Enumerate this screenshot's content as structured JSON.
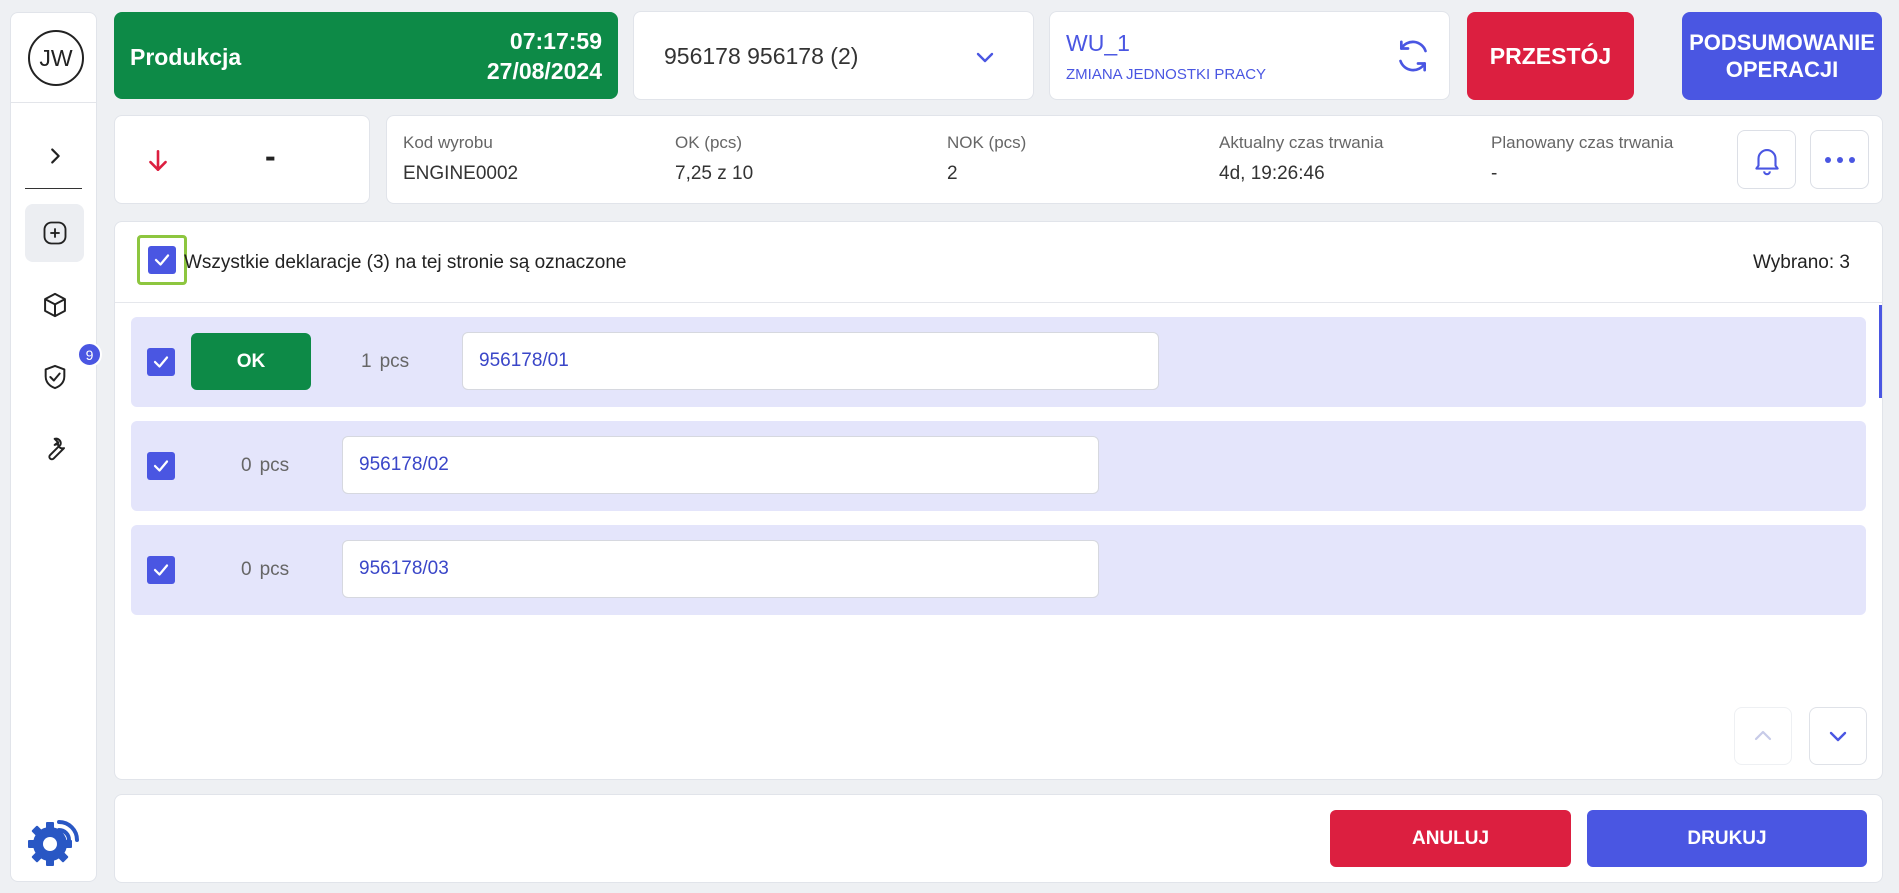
{
  "sidebar": {
    "avatar_initials": "JW",
    "badge_count": "9",
    "items": [
      {
        "icon": "chevron-right-icon"
      },
      {
        "icon": "plus-circle-icon"
      },
      {
        "icon": "cube-icon"
      },
      {
        "icon": "shield-check-icon"
      },
      {
        "icon": "wrench-icon"
      }
    ],
    "logo_icon": "gear-signal-logo-icon"
  },
  "header": {
    "status_label": "Produkcja",
    "time": "07:17:59",
    "date": "27/08/2024",
    "order": "956178 956178  (2)",
    "work_unit": "WU_1",
    "work_unit_sub": "ZMIANA JEDNOSTKI PRACY",
    "downtime_button": "PRZESTÓJ",
    "summary_button_line1": "PODSUMOWANIE",
    "summary_button_line2": "OPERACJI"
  },
  "info": {
    "trend_value": "-",
    "product_code_label": "Kod wyrobu",
    "product_code": "ENGINE0002",
    "ok_label": "OK (pcs)",
    "ok_value": "7,25 z 10",
    "nok_label": "NOK (pcs)",
    "nok_value": "2",
    "actual_duration_label": "Aktualny czas trwania",
    "actual_duration": "4d, 19:26:46",
    "planned_duration_label": "Planowany czas trwania",
    "planned_duration": "-"
  },
  "main": {
    "select_all_label": "Wszystkie deklaracje (3) na tej stronie są oznaczone",
    "selected_count": "Wybrano: 3",
    "rows": [
      {
        "status": "OK",
        "qty": "1",
        "unit": "pcs",
        "serial": "956178/01"
      },
      {
        "status": "",
        "qty": "0",
        "unit": "pcs",
        "serial": "956178/02"
      },
      {
        "status": "",
        "qty": "0",
        "unit": "pcs",
        "serial": "956178/03"
      }
    ]
  },
  "footer": {
    "cancel_button": "ANULUJ",
    "print_button": "DRUKUJ"
  },
  "colors": {
    "green": "#0d8a47",
    "red": "#dc1f40",
    "blue": "#4a56e2",
    "row_bg": "#e4e5fb"
  }
}
